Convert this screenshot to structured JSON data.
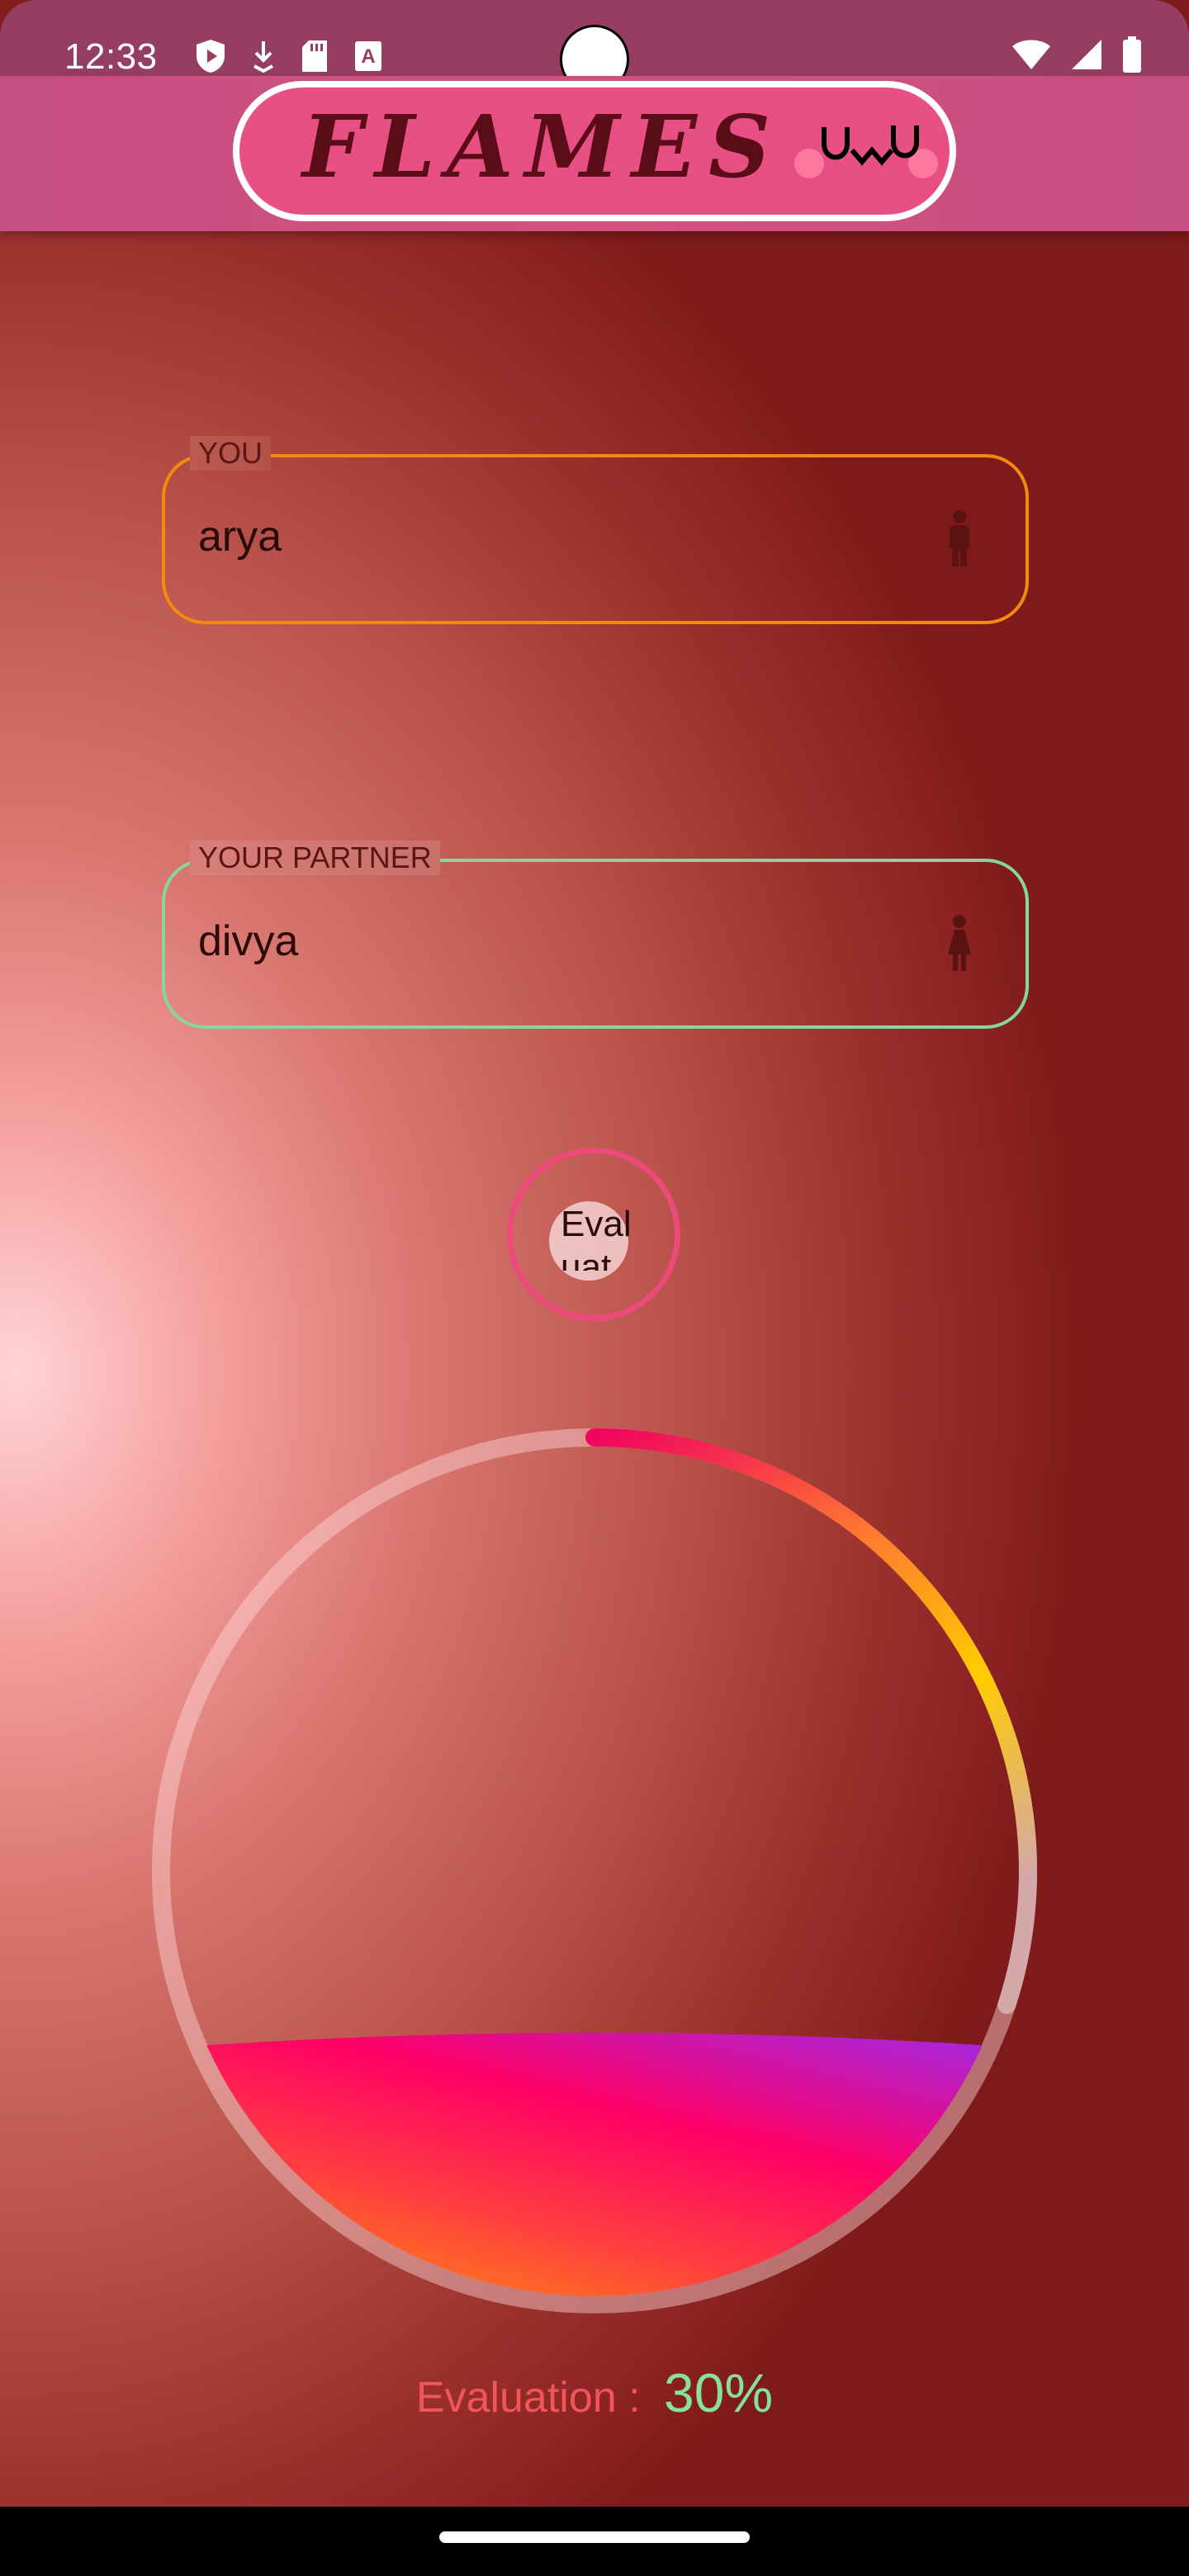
{
  "status_bar": {
    "time": "12:33",
    "left_icons": [
      "play-protect-icon",
      "download-icon",
      "sd-card-icon",
      "keyboard-a-icon"
    ],
    "right_icons": [
      "wifi-icon",
      "cell-signal-icon",
      "battery-icon"
    ]
  },
  "app_bar": {
    "title": "FLAMES",
    "mascot": "uwu-face-icon",
    "colors": {
      "bar": "#c64e80",
      "pill": "#e84f84",
      "title": "#5a0d17"
    }
  },
  "form": {
    "you": {
      "label": "YOU",
      "value": "arya",
      "icon": "male-person-icon",
      "border_color": "#f3890f"
    },
    "partner": {
      "label": "YOUR PARTNER",
      "value": "divya",
      "icon": "female-person-icon",
      "border_color": "#86d6a0"
    }
  },
  "evaluate_button": {
    "label": "Evaluat",
    "border_color": "#ec4a7a"
  },
  "gauge": {
    "progress_percent": 30,
    "fill_percent": 30,
    "arc_colors": [
      "#f0055f",
      "#ff7a30",
      "#ffcc00",
      "#d4a8a8"
    ],
    "fill_colors": [
      "#ff8c10",
      "#ff0066",
      "#9b2cf0"
    ]
  },
  "result": {
    "label": "Evaluation",
    "separator": ":",
    "value": "30%"
  }
}
